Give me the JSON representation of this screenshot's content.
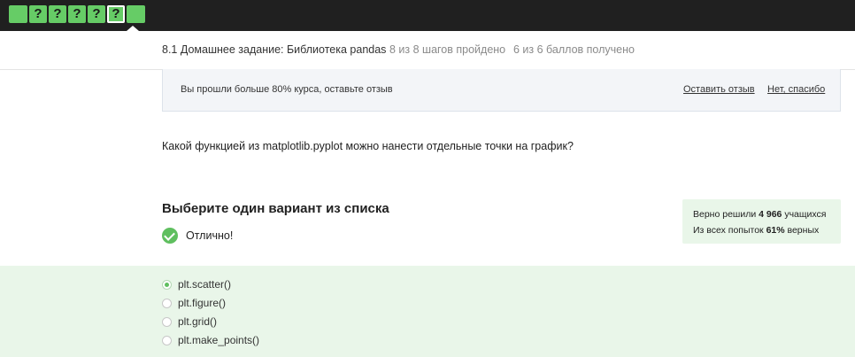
{
  "steps": [
    {
      "label": ""
    },
    {
      "label": "?"
    },
    {
      "label": "?"
    },
    {
      "label": "?"
    },
    {
      "label": "?"
    },
    {
      "label": "?"
    },
    {
      "label": ""
    }
  ],
  "header": {
    "lesson": "8.1 Домашнее задание: Библиотека pandas",
    "progress": "8 из 8 шагов пройдено",
    "score": "6 из 6 баллов  получено"
  },
  "banner": {
    "message": "Вы прошли больше 80% курса, оставьте отзыв",
    "leave_review": "Оставить отзыв",
    "no_thanks": "Нет, спасибо"
  },
  "question": "Какой функцией из matplotlib.pyplot можно нанести отдельные точки на график?",
  "choose_title": "Выберите один вариант из списка",
  "result_text": "Отлично!",
  "stats": {
    "solved_prefix": "Верно решили ",
    "solved_count": "4 966",
    "solved_suffix": " учащихся",
    "attempts_prefix": "Из всех попыток ",
    "attempts_pct": "61%",
    "attempts_suffix": " верных"
  },
  "options": [
    {
      "label": "plt.scatter()",
      "selected": true
    },
    {
      "label": "plt.figure()",
      "selected": false
    },
    {
      "label": "plt.grid()",
      "selected": false
    },
    {
      "label": "plt.make_points()",
      "selected": false
    }
  ],
  "colors": {
    "topbar": "#202020",
    "step_green": "#66cc66",
    "success_green": "#5fbf5f",
    "answers_bg": "#e9f6e9",
    "banner_bg": "#f3f5f8"
  }
}
